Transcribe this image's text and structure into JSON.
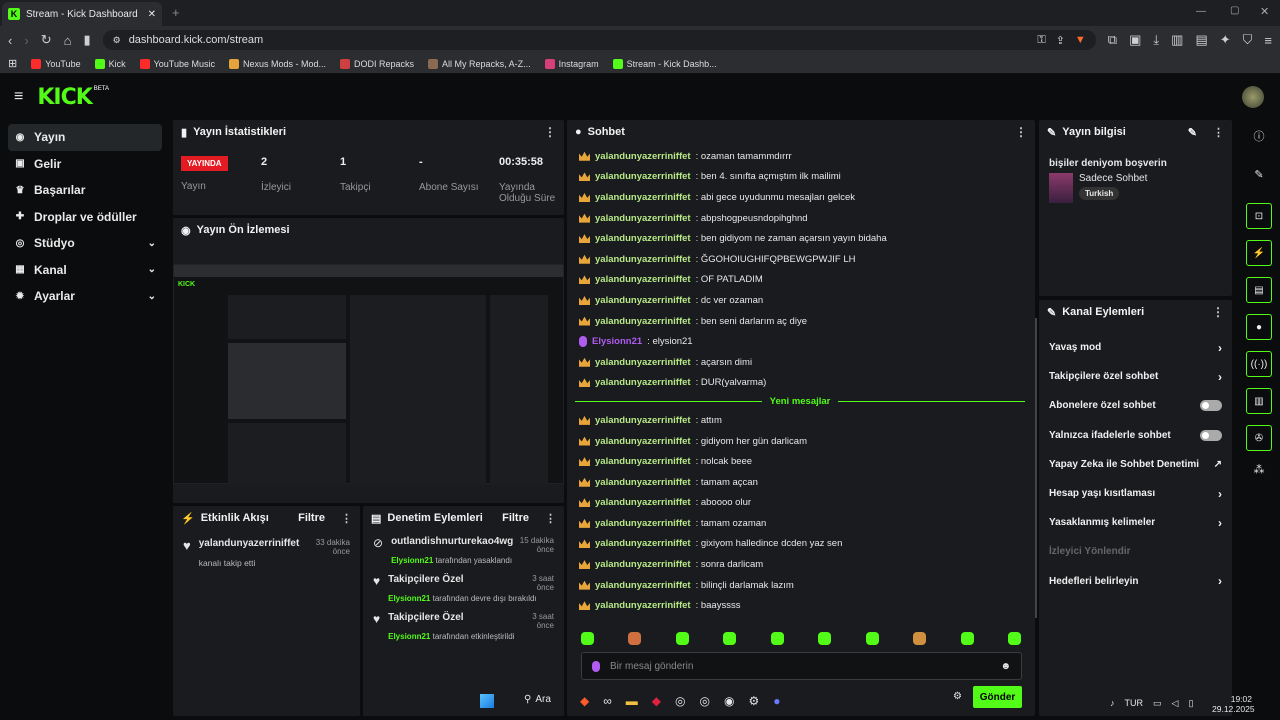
{
  "browser": {
    "tab_title": "Stream - Kick Dashboard",
    "new_tab": "+",
    "url": "dashboard.kick.com/stream",
    "bookmarks": [
      {
        "label": "YouTube",
        "color": "#ff2a2a"
      },
      {
        "label": "Kick",
        "color": "#53fc18"
      },
      {
        "label": "YouTube Music",
        "color": "#ff2a2a"
      },
      {
        "label": "Nexus Mods - Mod...",
        "color": "#e6a33a"
      },
      {
        "label": "DODI Repacks",
        "color": "#d04040"
      },
      {
        "label": "All My Repacks, A-Z...",
        "color": "#8a6a50"
      },
      {
        "label": "Instagram",
        "color": "#d6407a"
      },
      {
        "label": "Stream - Kick Dashb...",
        "color": "#53fc18"
      }
    ]
  },
  "header": {
    "logo": "KICK",
    "beta": "BETA"
  },
  "sidebar": {
    "items": [
      {
        "label": "Yayın",
        "icon": "broadcast-icon",
        "chev": false
      },
      {
        "label": "Gelir",
        "icon": "money-icon",
        "chev": false
      },
      {
        "label": "Başarılar",
        "icon": "trophy-icon",
        "chev": false
      },
      {
        "label": "Droplar ve ödüller",
        "icon": "gift-icon",
        "chev": false
      },
      {
        "label": "Stüdyo",
        "icon": "studio-icon",
        "chev": true
      },
      {
        "label": "Kanal",
        "icon": "channel-icon",
        "chev": true
      },
      {
        "label": "Ayarlar",
        "icon": "gear-icon",
        "chev": true
      }
    ]
  },
  "stats": {
    "title": "Yayın İstatistikleri",
    "live_badge": "YAYINDA",
    "live_label": "Yayın",
    "viewers": "2",
    "viewers_label": "İzleyici",
    "followers": "1",
    "followers_label": "Takipçi",
    "subs": "-",
    "subs_label": "Abone Sayısı",
    "uptime": "00:35:58",
    "uptime_label": "Yayında Olduğu Süre"
  },
  "preview": {
    "title": "Yayın Ön İzlemesi"
  },
  "activity": {
    "title": "Etkinlik Akışı",
    "filter": "Filtre",
    "items": [
      {
        "user": "yalandunyazerriniffet",
        "time": "33 dakika önce",
        "desc": "kanalı takip etti"
      }
    ]
  },
  "moderation": {
    "title": "Denetim Eylemleri",
    "filter": "Filtre",
    "items": [
      {
        "title": "outlandishnurturekao4wg",
        "time": "15 dakika önce",
        "actor": "Elysionn21",
        "desc": "tarafından yasaklandı"
      },
      {
        "title": "Takipçilere Özel",
        "time": "3 saat önce",
        "actor": "Elysionn21",
        "desc": "tarafından devre dışı bırakıldı"
      },
      {
        "title": "Takipçilere Özel",
        "time": "3 saat önce",
        "actor": "Elysionn21",
        "desc": "tarafından etkinleştirildi"
      }
    ]
  },
  "chat": {
    "title": "Sohbet",
    "new_messages": "Yeni mesajlar",
    "placeholder": "Bir mesaj gönderin",
    "send": "Gönder",
    "messages_before": [
      {
        "user": "yalandunyazerriniffet",
        "text": "ozaman tamammdırrr"
      },
      {
        "user": "yalandunyazerriniffet",
        "text": "ben 4. sınıfta açmıştım ilk mailimi"
      },
      {
        "user": "yalandunyazerriniffet",
        "text": "abi gece uyudunmu mesajları gelcek"
      },
      {
        "user": "yalandunyazerriniffet",
        "text": "abpshogpeusndopihghnd"
      },
      {
        "user": "yalandunyazerriniffet",
        "text": "ben gidiyom ne zaman açarsın yayın bidaha"
      },
      {
        "user": "yalandunyazerriniffet",
        "text": "ĞGOHOIUGHIFQPBEWGPWJIF LH"
      },
      {
        "user": "yalandunyazerriniffet",
        "text": "OF PATLADIM"
      },
      {
        "user": "yalandunyazerriniffet",
        "text": "dc ver ozaman"
      },
      {
        "user": "yalandunyazerriniffet",
        "text": "ben seni darlarım aç diye"
      },
      {
        "user": "Elysionn21",
        "text": "elysion21",
        "mod": true
      },
      {
        "user": "yalandunyazerriniffet",
        "text": "açarsın dimi"
      },
      {
        "user": "yalandunyazerriniffet",
        "text": "DUR(yalvarma)"
      }
    ],
    "messages_after": [
      {
        "user": "yalandunyazerriniffet",
        "text": "attım"
      },
      {
        "user": "yalandunyazerriniffet",
        "text": "gidiyom her gün darlicam"
      },
      {
        "user": "yalandunyazerriniffet",
        "text": "nolcak beee"
      },
      {
        "user": "yalandunyazerriniffet",
        "text": "tamam açcan"
      },
      {
        "user": "yalandunyazerriniffet",
        "text": "aboooo olur"
      },
      {
        "user": "yalandunyazerriniffet",
        "text": "tamam ozaman"
      },
      {
        "user": "yalandunyazerriniffet",
        "text": "gixiyom halledince dcden yaz sen"
      },
      {
        "user": "yalandunyazerriniffet",
        "text": "sonra darlicam"
      },
      {
        "user": "yalandunyazerriniffet",
        "text": "bilinçli darlamak lazım"
      },
      {
        "user": "yalandunyazerriniffet",
        "text": "baayssss"
      }
    ]
  },
  "info": {
    "title": "Yayın bilgisi",
    "stream_title": "bişiler deniyom boşverin",
    "category": "Sadece Sohbet",
    "language": "Turkish"
  },
  "actions": {
    "title": "Kanal Eylemleri",
    "items": [
      {
        "label": "Yavaş mod",
        "kind": "arrow"
      },
      {
        "label": "Takipçilere özel sohbet",
        "kind": "arrow"
      },
      {
        "label": "Abonelere özel sohbet",
        "kind": "toggle"
      },
      {
        "label": "Yalnızca ifadelerle sohbet",
        "kind": "toggle"
      },
      {
        "label": "Yapay Zeka ile Sohbet Denetimi",
        "kind": "ext"
      },
      {
        "label": "Hesap yaşı kısıtlaması",
        "kind": "arrow"
      },
      {
        "label": "Yasaklanmış kelimeler",
        "kind": "arrow"
      },
      {
        "label": "İzleyici Yönlendir",
        "kind": "disabled"
      },
      {
        "label": "Hedefleri belirleyin",
        "kind": "arrow"
      }
    ]
  },
  "taskbar": {
    "search": "Ara",
    "lang": "TUR",
    "time": "19:02",
    "date": "29.12.2025"
  }
}
